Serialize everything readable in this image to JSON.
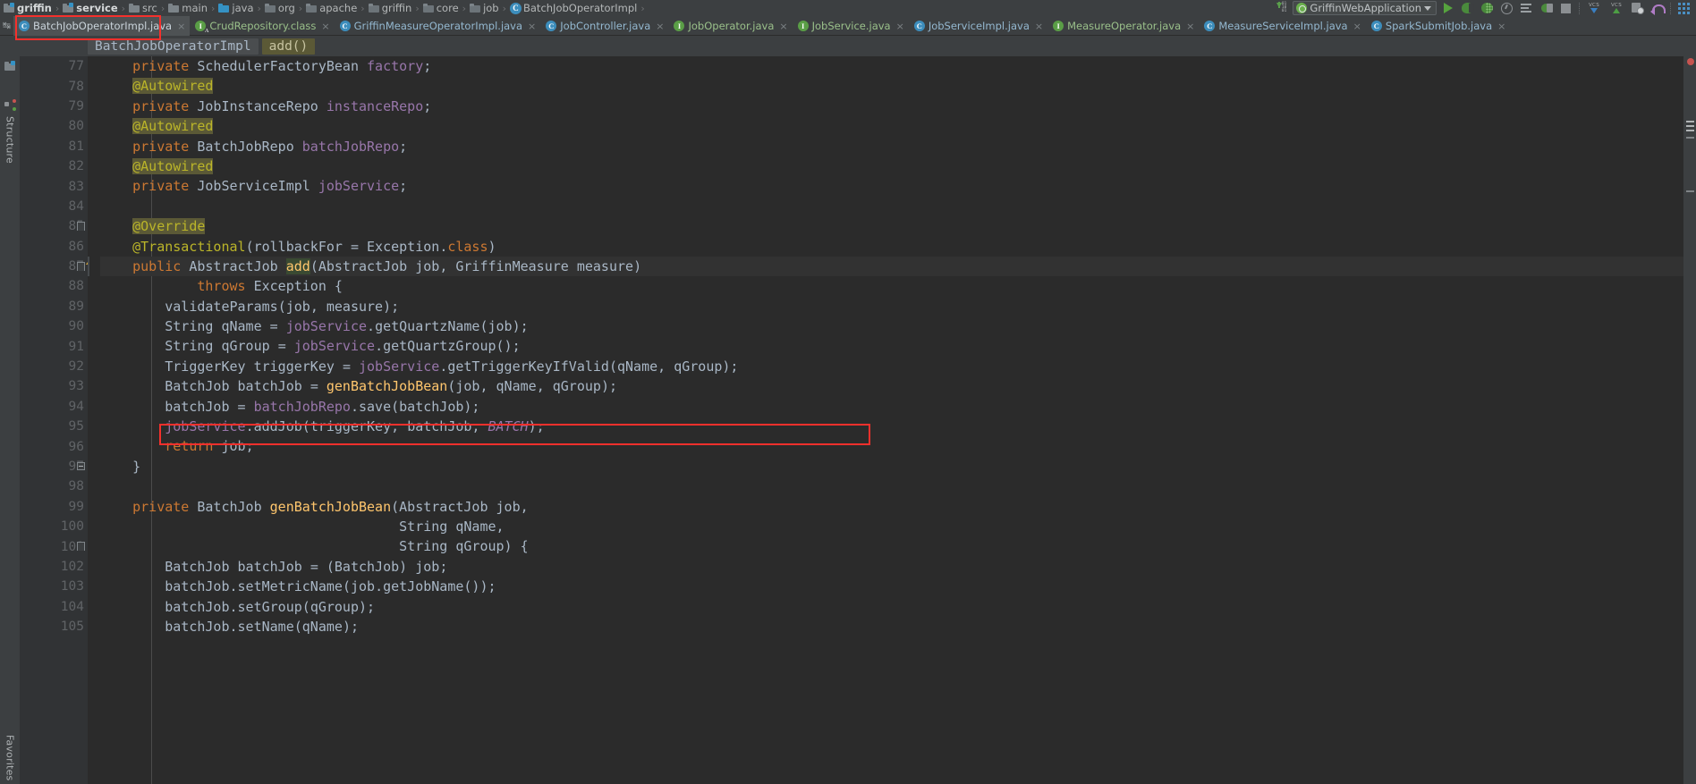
{
  "navbar": {
    "breadcrumbs": [
      {
        "label": "griffin",
        "icon": "folder-module-icon",
        "bold": true
      },
      {
        "label": "service",
        "icon": "folder-module-icon",
        "bold": true
      },
      {
        "label": "src",
        "icon": "folder-icon",
        "bold": false
      },
      {
        "label": "main",
        "icon": "folder-icon",
        "bold": false
      },
      {
        "label": "java",
        "icon": "folder-source-icon",
        "bold": false
      },
      {
        "label": "org",
        "icon": "folder-package-icon",
        "bold": false
      },
      {
        "label": "apache",
        "icon": "folder-package-icon",
        "bold": false
      },
      {
        "label": "griffin",
        "icon": "folder-package-icon",
        "bold": false
      },
      {
        "label": "core",
        "icon": "folder-package-icon",
        "bold": false
      },
      {
        "label": "job",
        "icon": "folder-package-icon",
        "bold": false
      },
      {
        "label": "BatchJobOperatorImpl",
        "icon": "java-class-icon",
        "bold": false
      }
    ],
    "separator": "›",
    "run_config": "GriffinWebApplication",
    "toolbar_icons": [
      "download-updates-icon",
      "run-icon",
      "debug-icon",
      "coverage-icon",
      "profile-icon",
      "run-with-icon",
      "attach-debugger-icon",
      "stop-icon",
      "vcs-update-icon",
      "vcs-commit-icon",
      "vcs-history-icon",
      "vcs-rollback-icon",
      "database-icon"
    ],
    "vcs_update_label": "VCS",
    "vcs_commit_label": "VCS"
  },
  "tabs": {
    "pin_icon": "pin-tabs-icon",
    "close_glyph": "×",
    "items": [
      {
        "label": "BatchJobOperatorImpl.java",
        "icon": "java-class-icon",
        "kind": "class",
        "active": true
      },
      {
        "label": "CrudRepository.class",
        "icon": "java-interface-abstract-icon",
        "kind": "interface-abstract",
        "active": false
      },
      {
        "label": "GriffinMeasureOperatorImpl.java",
        "icon": "java-class-icon",
        "kind": "class",
        "active": false
      },
      {
        "label": "JobController.java",
        "icon": "java-class-icon",
        "kind": "class",
        "active": false
      },
      {
        "label": "JobOperator.java",
        "icon": "java-interface-icon",
        "kind": "interface",
        "active": false
      },
      {
        "label": "JobService.java",
        "icon": "java-interface-icon",
        "kind": "interface",
        "active": false
      },
      {
        "label": "JobServiceImpl.java",
        "icon": "java-class-icon",
        "kind": "class",
        "active": false
      },
      {
        "label": "MeasureOperator.java",
        "icon": "java-interface-icon",
        "kind": "interface",
        "active": false
      },
      {
        "label": "MeasureServiceImpl.java",
        "icon": "java-class-icon",
        "kind": "class",
        "active": false
      },
      {
        "label": "SparkSubmitJob.java",
        "icon": "java-class-icon",
        "kind": "class",
        "active": false
      }
    ]
  },
  "structure_breadcrumb": {
    "class": "BatchJobOperatorImpl",
    "method": "add()"
  },
  "left_rail": {
    "project_label": "Project",
    "structure_label": "Structure",
    "favorites_label": "Favorites",
    "project_icon": "project-tool-window-icon",
    "structure_icon": "structure-tool-window-icon",
    "favorites_icon": "favorites-icon"
  },
  "editor": {
    "first_line": 77,
    "lines": [
      {
        "n": 77,
        "gutter": "",
        "fold": "",
        "text": "    private SchedulerFactoryBean factory;"
      },
      {
        "n": 78,
        "gutter": "",
        "fold": "",
        "text": "    @Autowired"
      },
      {
        "n": 79,
        "gutter": "override-icon",
        "fold": "",
        "text": "    private JobInstanceRepo instanceRepo;"
      },
      {
        "n": 80,
        "gutter": "",
        "fold": "",
        "text": "    @Autowired"
      },
      {
        "n": 81,
        "gutter": "override-icon",
        "fold": "",
        "text": "    private BatchJobRepo batchJobRepo;"
      },
      {
        "n": 82,
        "gutter": "",
        "fold": "",
        "text": "    @Autowired"
      },
      {
        "n": 83,
        "gutter": "override-icon",
        "fold": "",
        "text": "    private JobServiceImpl jobService;"
      },
      {
        "n": 84,
        "gutter": "",
        "fold": "",
        "text": ""
      },
      {
        "n": 85,
        "gutter": "",
        "fold": "fold-open",
        "text": "    @Override"
      },
      {
        "n": 86,
        "gutter": "",
        "fold": "",
        "text": "    @Transactional(rollbackFor = Exception.class)"
      },
      {
        "n": 87,
        "gutter": "implements-icon",
        "fold": "fold-region",
        "text": "    public AbstractJob add(AbstractJob job, GriffinMeasure measure)"
      },
      {
        "n": 88,
        "gutter": "",
        "fold": "",
        "text": "            throws Exception {"
      },
      {
        "n": 89,
        "gutter": "",
        "fold": "",
        "text": "        validateParams(job, measure);"
      },
      {
        "n": 90,
        "gutter": "",
        "fold": "",
        "text": "        String qName = jobService.getQuartzName(job);"
      },
      {
        "n": 91,
        "gutter": "",
        "fold": "",
        "text": "        String qGroup = jobService.getQuartzGroup();"
      },
      {
        "n": 92,
        "gutter": "",
        "fold": "",
        "text": "        TriggerKey triggerKey = jobService.getTriggerKeyIfValid(qName, qGroup);"
      },
      {
        "n": 93,
        "gutter": "",
        "fold": "",
        "text": "        BatchJob batchJob = genBatchJobBean(job, qName, qGroup);"
      },
      {
        "n": 94,
        "gutter": "",
        "fold": "",
        "text": "        batchJob = batchJobRepo.save(batchJob);"
      },
      {
        "n": 95,
        "gutter": "",
        "fold": "",
        "text": "        jobService.addJob(triggerKey, batchJob, BATCH);"
      },
      {
        "n": 96,
        "gutter": "",
        "fold": "",
        "text": "        return job;"
      },
      {
        "n": 97,
        "gutter": "",
        "fold": "fold-end",
        "text": "    }"
      },
      {
        "n": 98,
        "gutter": "",
        "fold": "",
        "text": ""
      },
      {
        "n": 99,
        "gutter": "",
        "fold": "",
        "text": "    private BatchJob genBatchJobBean(AbstractJob job,"
      },
      {
        "n": 100,
        "gutter": "",
        "fold": "",
        "text": "                                     String qName,"
      },
      {
        "n": 101,
        "gutter": "",
        "fold": "fold-region",
        "text": "                                     String qGroup) {"
      },
      {
        "n": 102,
        "gutter": "",
        "fold": "",
        "text": "        BatchJob batchJob = (BatchJob) job;"
      },
      {
        "n": 103,
        "gutter": "",
        "fold": "",
        "text": "        batchJob.setMetricName(job.getJobName());"
      },
      {
        "n": 104,
        "gutter": "",
        "fold": "",
        "text": "        batchJob.setGroup(qGroup);"
      },
      {
        "n": 105,
        "gutter": "",
        "fold": "",
        "text": "        batchJob.setName(qName);"
      }
    ],
    "caret_line": 87,
    "caret_word": "add",
    "highlighted_line": 95
  },
  "annotations": {
    "box_tab_label": "BatchJobOperatorImpl.java",
    "box_code_label": "jobService.addJob(triggerKey, batchJob, BATCH);",
    "box_color": "#f5302c"
  },
  "colors": {
    "background": "#2b2b2b",
    "chrome": "#3c3f41",
    "gutter": "#313335",
    "keyword": "#cc7832",
    "annotation": "#bbb529",
    "field": "#9876aa",
    "method": "#ffc66d",
    "plain": "#a9b7c6",
    "active_tab": "#4e5254",
    "accent_blue": "#3c8dbc",
    "accent_green": "#5a9e46"
  }
}
